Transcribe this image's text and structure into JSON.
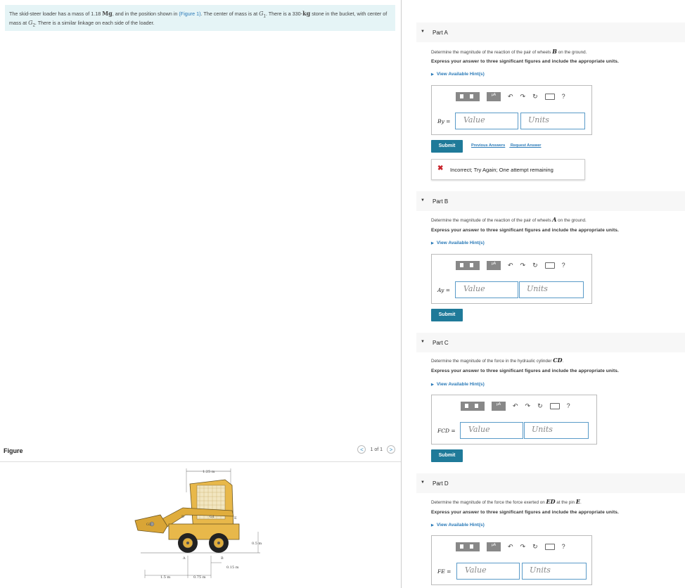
{
  "problem": {
    "t1": "The skid-steer loader has a mass of 1.18 ",
    "unit_mg": "Mg",
    "t2": ", and in the position shown in ",
    "figure_link": "(Figure 1)",
    "t3": ". The center of mass is at ",
    "g1": "G",
    "g1_sub": "1",
    "t4": ". There is a 330-",
    "unit_kg": "kg",
    "t5": " stone in the bucket, with center of mass at ",
    "g2": "G",
    "g2_sub": "2",
    "t6": ". There is a similar linkage on each side of the loader."
  },
  "figure_panel": {
    "title": "Figure",
    "pager": "1 of 1",
    "prev": "<",
    "next": ">",
    "labels": {
      "d125": "1.25 m",
      "d05": "0.5 m",
      "d015": "0.15 m",
      "d15": "1.5 m",
      "d075": "0.75 m",
      "A": "A",
      "B": "B",
      "C": "C",
      "D": "D",
      "E": "E",
      "G1": "G1",
      "G2": "G2"
    }
  },
  "common": {
    "express": "Express your answer to three significant figures and include the appropriate units.",
    "hint": "View Available Hint(s)",
    "value_placeholder": "Value",
    "units_placeholder": "Units",
    "submit": "Submit",
    "mu": "μA",
    "question_icon": "?"
  },
  "parts": [
    {
      "label": "Part A",
      "question_pre": "Determine the magnitude of the reaction of the pair of wheels ",
      "question_var": "B",
      "question_post": " on the ground.",
      "symbol": "By =",
      "previous_answers": "Previous Answers",
      "request_answer": "Request Answer",
      "feedback": "Incorrect; Try Again; One attempt remaining",
      "feedback_icon": "✖"
    },
    {
      "label": "Part B",
      "question_pre": "Determine the magnitude of the reaction of the pair of wheels ",
      "question_var": "A",
      "question_post": " on the ground.",
      "symbol": "Ay ="
    },
    {
      "label": "Part C",
      "question_pre": "Determine the magnitude of the force in the hydraulic cylinder ",
      "question_var": "CD",
      "question_post": ".",
      "symbol": "FCD ="
    },
    {
      "label": "Part D",
      "question_pre": "Determine the magnitude of the force the force exerted on ",
      "question_var": "ED",
      "question_post": " at the pin ",
      "question_var2": "E",
      "question_post2": ".",
      "symbol": "FE ="
    }
  ]
}
